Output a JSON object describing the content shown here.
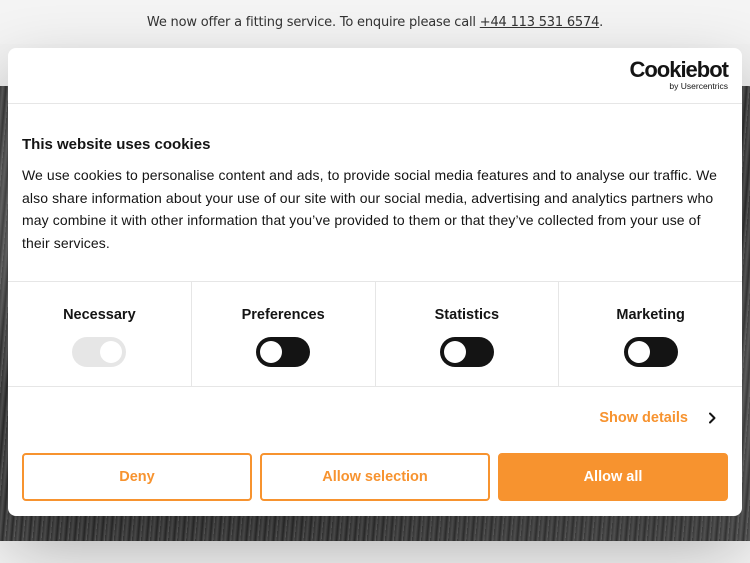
{
  "banner": {
    "text": "We now offer a fitting service. To enquire please call ",
    "phone": "+44 113 531 6574",
    "suffix": "."
  },
  "cookie_dialog": {
    "logo": {
      "main": "Cookiebot",
      "sub": "by Usercentrics"
    },
    "title": "This website uses cookies",
    "description": "We use cookies to personalise content and ads, to provide social media features and to analyse our traffic. We also share information about your use of our site with our social media, advertising and analytics partners who may combine it with other information that you’ve provided to them or that they’ve collected from your use of their services.",
    "categories": [
      {
        "label": "Necessary",
        "checked": true,
        "disabled": true
      },
      {
        "label": "Preferences",
        "checked": false,
        "disabled": false
      },
      {
        "label": "Statistics",
        "checked": false,
        "disabled": false
      },
      {
        "label": "Marketing",
        "checked": false,
        "disabled": false
      }
    ],
    "show_details": "Show details",
    "buttons": {
      "deny": "Deny",
      "allow_selection": "Allow selection",
      "allow_all": "Allow all"
    },
    "colors": {
      "accent": "#f7932f",
      "text": "#141414",
      "toggle_off": "#141414",
      "toggle_disabled": "#e6e6e6"
    }
  }
}
